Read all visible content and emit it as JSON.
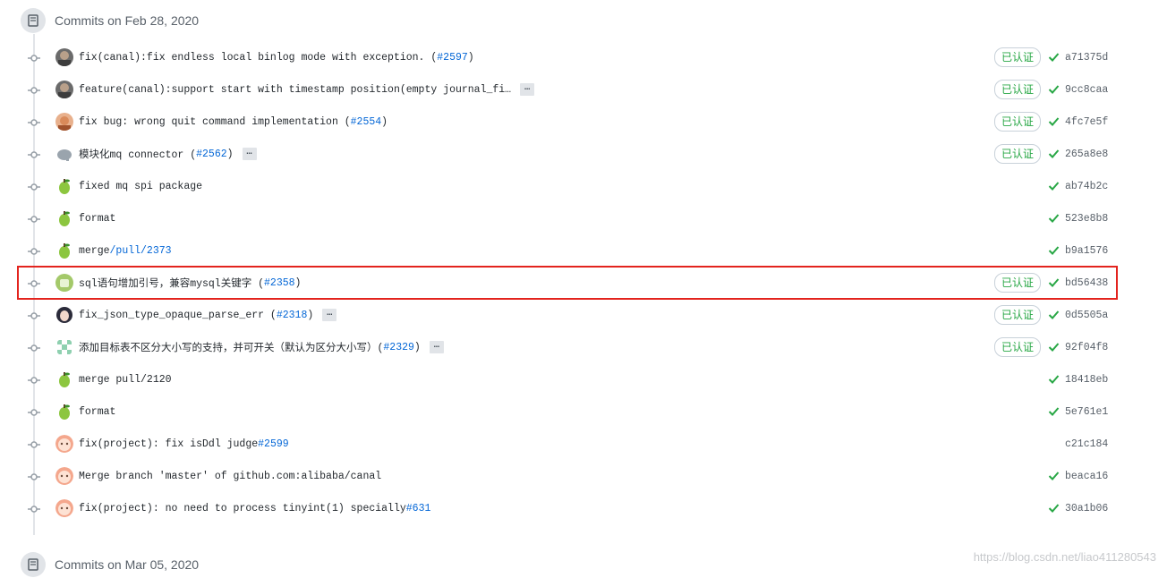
{
  "groups": [
    {
      "title": "Commits on Feb 28, 2020"
    },
    {
      "title": "Commits on Mar 05, 2020"
    }
  ],
  "verified_label": "已认证",
  "commits": [
    {
      "msg": "fix(canal):fix endless local binlog mode with exception. (",
      "link": "#2597",
      "tail": ")",
      "verified": true,
      "check": true,
      "sha": "a71375d",
      "ellipsis": false,
      "avatar": "photo"
    },
    {
      "msg": "feature(canal):support start with timestamp position(empty journal_fi…",
      "link": "",
      "tail": "",
      "verified": true,
      "check": true,
      "sha": "9cc8caa",
      "ellipsis": true,
      "avatar": "photo"
    },
    {
      "msg": "fix bug: wrong quit command implementation (",
      "link": "#2554",
      "tail": ")",
      "verified": true,
      "check": true,
      "sha": "4fc7e5f",
      "ellipsis": false,
      "avatar": "photo2"
    },
    {
      "msg": "模块化mq connector (",
      "link": "#2562",
      "tail": ")",
      "verified": true,
      "check": true,
      "sha": "265a8e8",
      "ellipsis": true,
      "avatar": "elephant"
    },
    {
      "msg": "fixed mq spi package",
      "link": "",
      "tail": "",
      "verified": false,
      "check": true,
      "sha": "ab74b2c",
      "ellipsis": false,
      "avatar": "pear"
    },
    {
      "msg": "format",
      "link": "",
      "tail": "",
      "verified": false,
      "check": true,
      "sha": "523e8b8",
      "ellipsis": false,
      "avatar": "pear"
    },
    {
      "msg": "merge ",
      "link": "/pull/2373",
      "tail": "",
      "verified": false,
      "check": true,
      "sha": "b9a1576",
      "ellipsis": false,
      "avatar": "pear"
    },
    {
      "msg": "sql语句增加引号，兼容mysql关键字 (",
      "link": "#2358",
      "tail": ")",
      "verified": true,
      "check": true,
      "sha": "bd56438",
      "ellipsis": false,
      "avatar": "android"
    },
    {
      "msg": "fix_json_type_opaque_parse_err (",
      "link": "#2318",
      "tail": ")",
      "verified": true,
      "check": true,
      "sha": "0d5505a",
      "ellipsis": true,
      "avatar": "girl"
    },
    {
      "msg": "添加目标表不区分大小写的支持，并可开关（默认为区分大小写）(",
      "link": "#2329",
      "tail": ")",
      "verified": true,
      "check": true,
      "sha": "92f04f8",
      "ellipsis": true,
      "avatar": "pixel"
    },
    {
      "msg": "merge pull/2120",
      "link": "",
      "tail": "",
      "verified": false,
      "check": true,
      "sha": "18418eb",
      "ellipsis": false,
      "avatar": "pear"
    },
    {
      "msg": "format",
      "link": "",
      "tail": "",
      "verified": false,
      "check": true,
      "sha": "5e761e1",
      "ellipsis": false,
      "avatar": "pear"
    },
    {
      "msg": "fix(project): fix isDdl judge ",
      "link": "#2599",
      "tail": "",
      "verified": false,
      "check": false,
      "sha": "c21c184",
      "ellipsis": false,
      "avatar": "face"
    },
    {
      "msg": "Merge branch 'master' of github.com:alibaba/canal",
      "link": "",
      "tail": "",
      "verified": false,
      "check": true,
      "sha": "beaca16",
      "ellipsis": false,
      "avatar": "face"
    },
    {
      "msg": "fix(project): no need to process tinyint(1) specially ",
      "link": "#631",
      "tail": "",
      "verified": false,
      "check": true,
      "sha": "30a1b06",
      "ellipsis": false,
      "avatar": "face"
    }
  ],
  "watermark": "https://blog.csdn.net/liao411280543"
}
